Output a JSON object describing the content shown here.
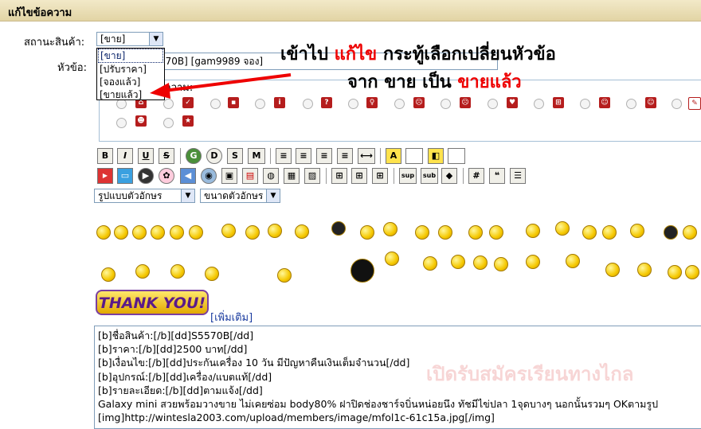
{
  "title": "แก้ไขข้อความ",
  "form": {
    "status_label": "สถานะสินค้า:",
    "status_value": "[ขาย]",
    "status_options": [
      "[ขาย]",
      "[ปรับราคา]",
      "[จองแล้ว]",
      "[ขายแล้ว]"
    ],
    "subject_label": "หัวข้อ:",
    "subject_value": "570B] [gam9989  จอง]",
    "icon_label": "ความ:"
  },
  "annotation": {
    "line1_a": "เข้าไป ",
    "line1_red": "แก้ไข",
    "line1_b": " กระทู้เลือกเปลี่ยนหัวข้อ",
    "line2_a": "จาก ขาย เป็น ",
    "line2_red": "ขายแล้ว",
    "accent": "#e00000"
  },
  "toolbar": {
    "row1": [
      "B",
      "I",
      "U",
      "S",
      "G",
      "D",
      "S",
      "M"
    ],
    "font_select": "รูปแบบตัวอักษร",
    "size_select": "ขนาดตัวอักษร"
  },
  "smilies": {
    "more_label": "[เพิ่มเติม]",
    "thank_label": "THANK YOU!"
  },
  "post_lines": [
    "[b]ชื่อสินค้า:[/b][dd]S5570B[/dd]",
    "[b]ราคา:[/b][dd]2500 บาท[/dd]",
    "[b]เงื่อนไข:[/b][dd]ประกันเครื่อง 10 วัน มีปัญหาคืนเงินเต็มจำนวน[/dd]",
    "[b]อุปกรณ์:[/b][dd]เครื่อง/แบตแท้[/dd]",
    "[b]รายละเอียด:[/b][dd]ตามแจ้ง[/dd]",
    "Galaxy mini สวยพร้อมวางขาย ไม่เคยซ่อม  body80% ฝาปิดช่องชาร์จบิ่นหน่อยนึง ทัชมีไข่ปลา 1จุดบางๆ นอกนั้นรวมๆ OKตามรูป",
    "[img]http://wintesla2003.com/upload/members/image/mfol1c-61c15a.jpg[/img]"
  ],
  "watermark": "เปิดรับสมัครเรียนทางไกล"
}
